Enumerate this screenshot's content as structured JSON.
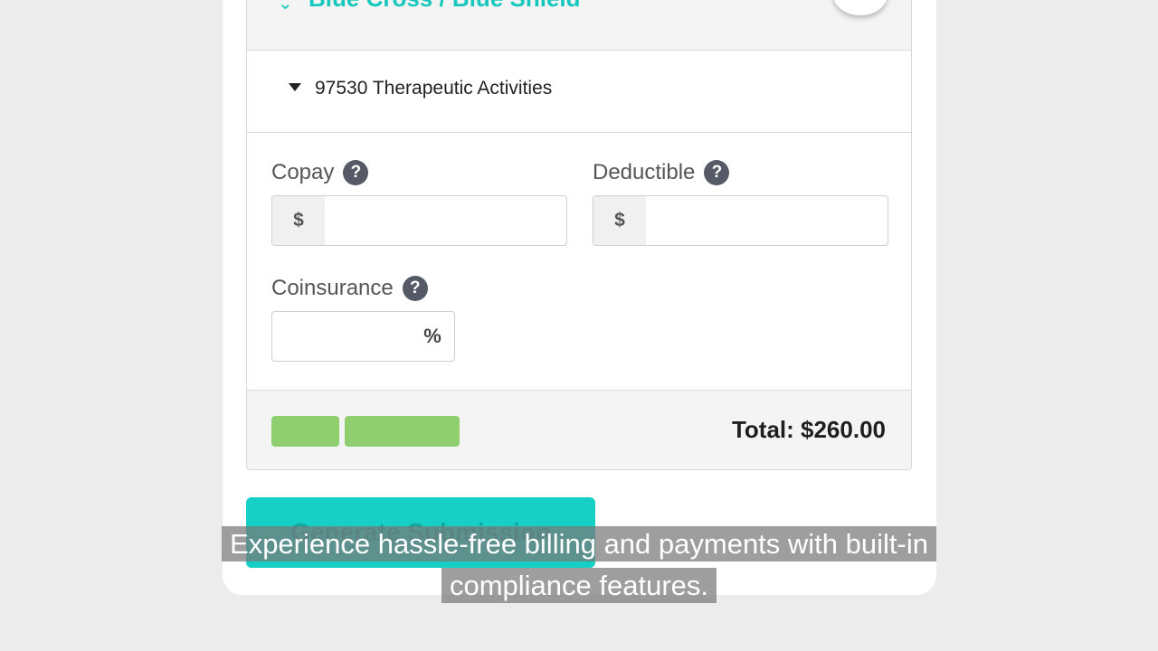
{
  "insurer": {
    "name": "Blue Cross / Blue Shield"
  },
  "procedure": {
    "label": "97530 Therapeutic Activities"
  },
  "fields": {
    "copay": {
      "label": "Copay",
      "prefix": "$",
      "value": ""
    },
    "deductible": {
      "label": "Deductible",
      "prefix": "$",
      "value": ""
    },
    "coinsurance": {
      "label": "Coinsurance",
      "suffix": "%",
      "value": ""
    },
    "help_glyph": "?"
  },
  "footer": {
    "total": "Total: $260.00"
  },
  "actions": {
    "generate_label": "Generate Submission"
  },
  "caption": {
    "line1": "Experience hassle-free billing and payments with built-in",
    "line2": "compliance features."
  },
  "colors": {
    "accent": "#17d0c5",
    "green": "#8fcf70",
    "help_icon": "#555a66"
  }
}
